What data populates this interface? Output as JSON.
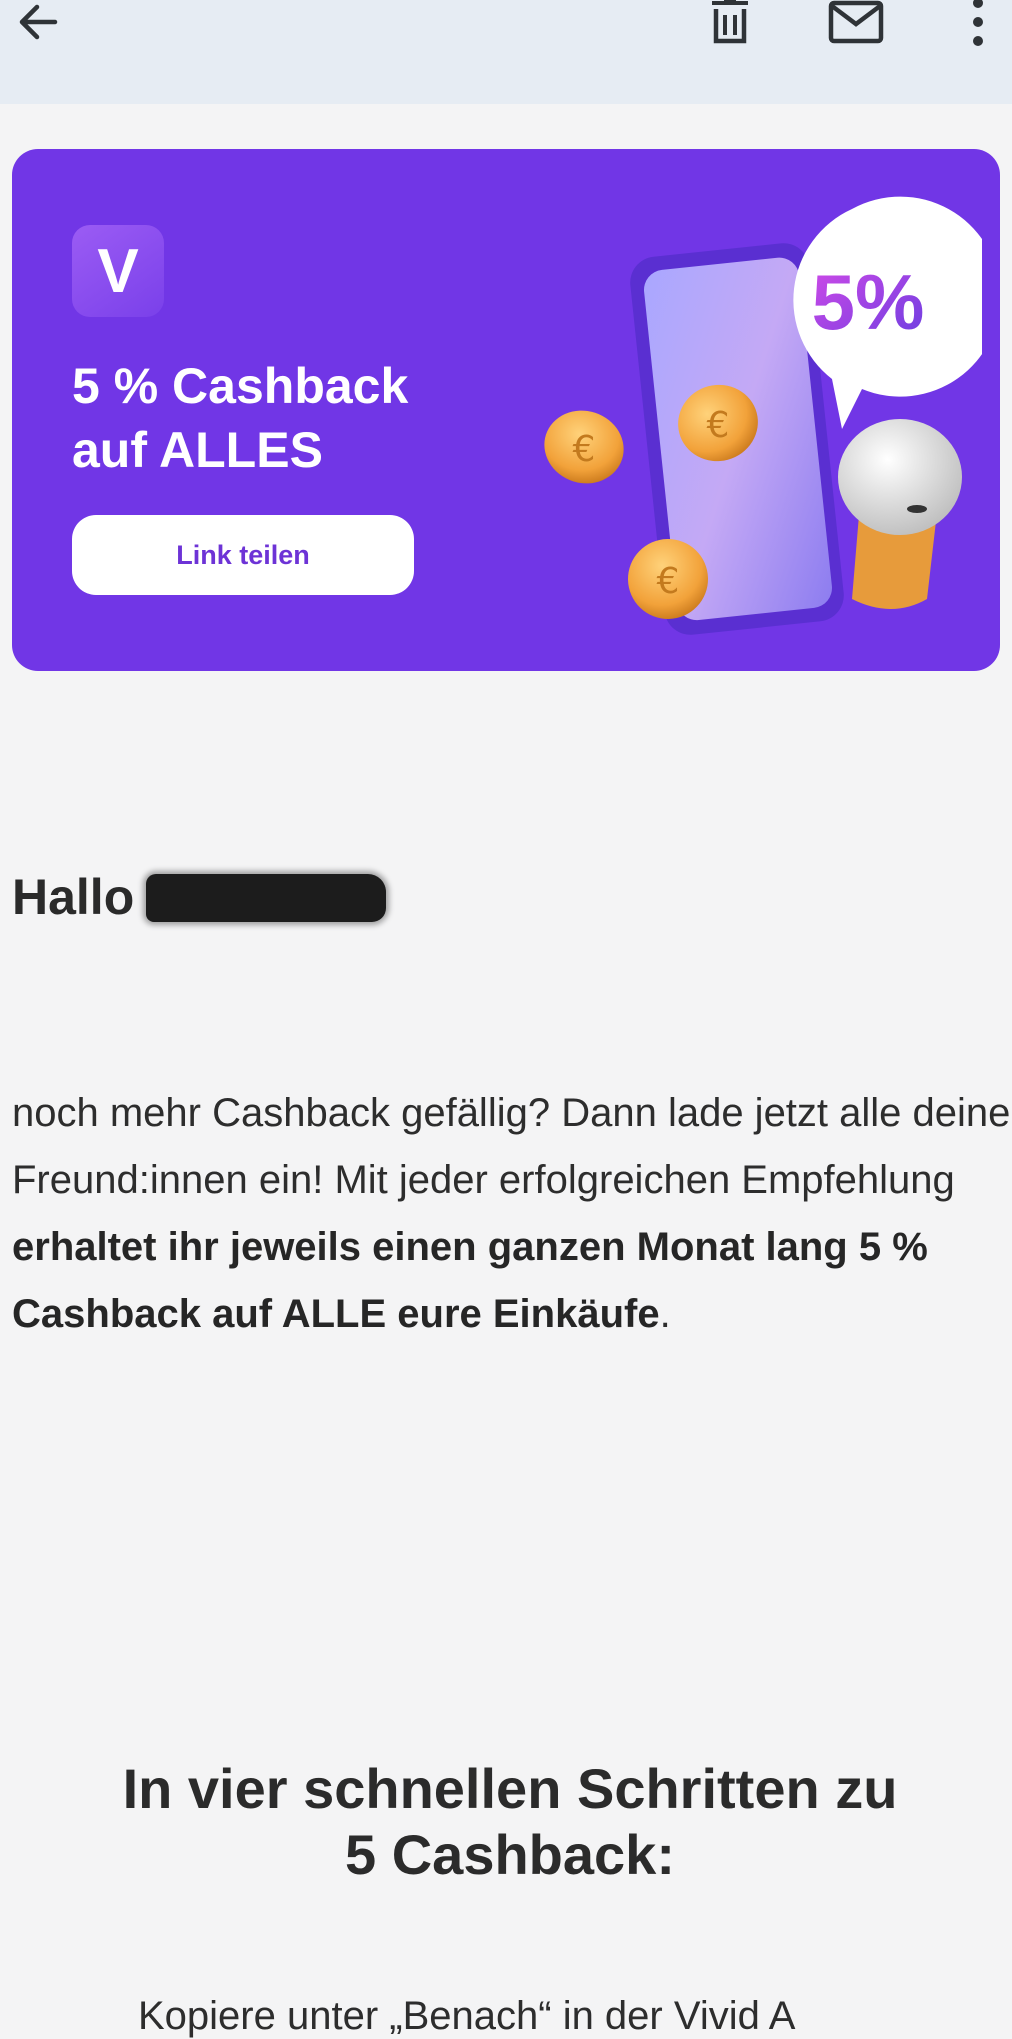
{
  "toolbar": {
    "back_icon": "arrow-left-icon",
    "delete_icon": "trash-icon",
    "mail_icon": "mail-icon",
    "more_icon": "more-vertical-icon"
  },
  "banner": {
    "logo_letter": "V",
    "title_line1": "5 % Cashback",
    "title_line2": "auf ALLES",
    "button_label": "Link teilen",
    "badge_text": "5%",
    "background_color": "#7136e6"
  },
  "greeting": {
    "prefix": "Hallo",
    "name_redacted": true
  },
  "intro": {
    "text_plain": "noch mehr Cashback gefällig? Dann lade jetzt alle deine Freund:innen ein! Mit jeder erfolgreichen Empfehlung ",
    "text_bold": "erhaltet ihr jeweils einen ganzen Monat lang 5 % Cashback auf ALLE eure Einkäufe",
    "text_end": "."
  },
  "steps": {
    "heading_line1": "In vier schnellen Schritten zu",
    "heading_line2": "5 Cashback:",
    "first_step_partial": "Kopiere unter „Benach“ in der Vivid A"
  }
}
